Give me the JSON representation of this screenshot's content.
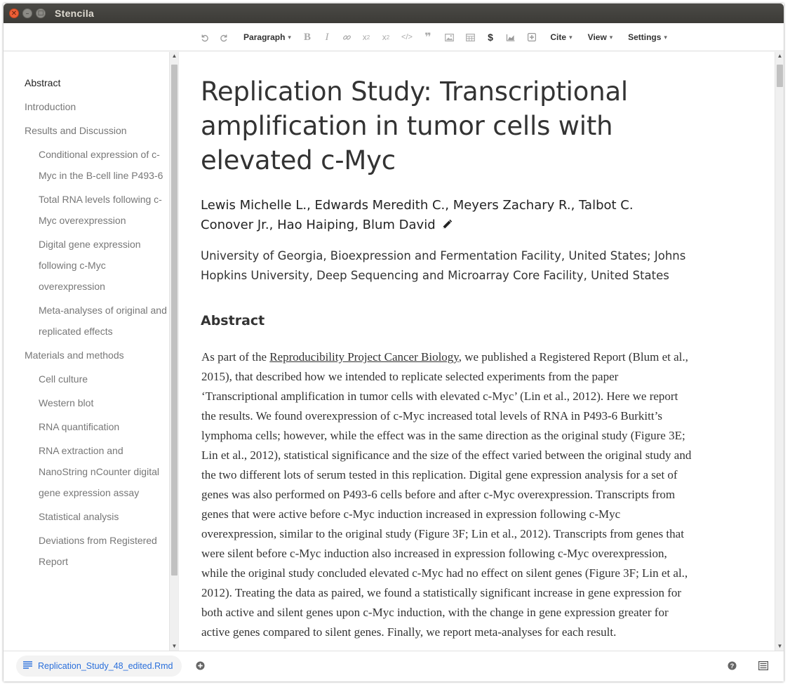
{
  "window": {
    "title": "Stencila"
  },
  "toolbar": {
    "paragraph_label": "Paragraph",
    "cite_label": "Cite",
    "view_label": "View",
    "settings_label": "Settings",
    "dollar_glyph": "$"
  },
  "toc": {
    "items": [
      {
        "label": "Abstract",
        "level": 1,
        "active": true
      },
      {
        "label": "Introduction",
        "level": 1
      },
      {
        "label": "Results and Discussion",
        "level": 1
      },
      {
        "label": "Conditional expression of c-Myc in the B-cell line P493-6",
        "level": 2
      },
      {
        "label": "Total RNA levels following c-Myc overexpression",
        "level": 2
      },
      {
        "label": "Digital gene expression following c-Myc overexpression",
        "level": 2
      },
      {
        "label": "Meta-analyses of original and replicated effects",
        "level": 2
      },
      {
        "label": "Materials and methods",
        "level": 1
      },
      {
        "label": "Cell culture",
        "level": 2
      },
      {
        "label": "Western blot",
        "level": 2
      },
      {
        "label": "RNA quantification",
        "level": 2
      },
      {
        "label": "RNA extraction and NanoString nCounter digital gene expression assay",
        "level": 2
      },
      {
        "label": "Statistical analysis",
        "level": 2
      },
      {
        "label": "Deviations from Registered Report",
        "level": 2
      }
    ]
  },
  "document": {
    "title": "Replication Study: Transcriptional amplification in tumor cells with elevated c-Myc",
    "authors": "Lewis Michelle L., Edwards Meredith C., Meyers Zachary R., Talbot C. Conover Jr., Hao Haiping, Blum David",
    "affiliations": "University of Georgia, Bioexpression and Fermentation Facility, United States; Johns Hopkins University, Deep Sequencing and Microarray Core Facility, United States",
    "abstract_heading": "Abstract",
    "abstract_prefix": "As part of the ",
    "abstract_link": "Reproducibility Project Cancer Biology",
    "abstract_rest": ", we published a Registered Report (Blum et al., 2015), that described how we intended to replicate selected experiments from the paper ‘Transcriptional amplification in tumor cells with elevated c-Myc’ (Lin et al., 2012). Here we report the results. We found overexpression of c-Myc increased total levels of RNA in P493-6 Burkitt’s lymphoma cells; however, while the effect was in the same direction as the original study (Figure 3E; Lin et al., 2012), statistical significance and the size of the effect varied between the original study and the two different lots of serum tested in this replication. Digital gene expression analysis for a set of genes was also performed on P493-6 cells before and after c-Myc overexpression. Transcripts from genes that were active before c-Myc induction increased in expression following c-Myc overexpression, similar to the original study (Figure 3F; Lin et al., 2012). Transcripts from genes that were silent before c-Myc induction also increased in expression following c-Myc overexpression, while the original study concluded elevated c-Myc had no effect on silent genes (Figure 3F; Lin et al., 2012). Treating the data as paired, we found a statistically significant increase in gene expression for both active and silent genes upon c-Myc induction, with the change in gene expression greater for active genes compared to silent genes. Finally, we report meta-analyses for each result."
  },
  "status": {
    "file_name": "Replication_Study_48_edited.Rmd"
  },
  "colors": {
    "link_blue": "#2a6fdb",
    "titlebar": "#3c3b37",
    "close_orange": "#ec5f37"
  }
}
